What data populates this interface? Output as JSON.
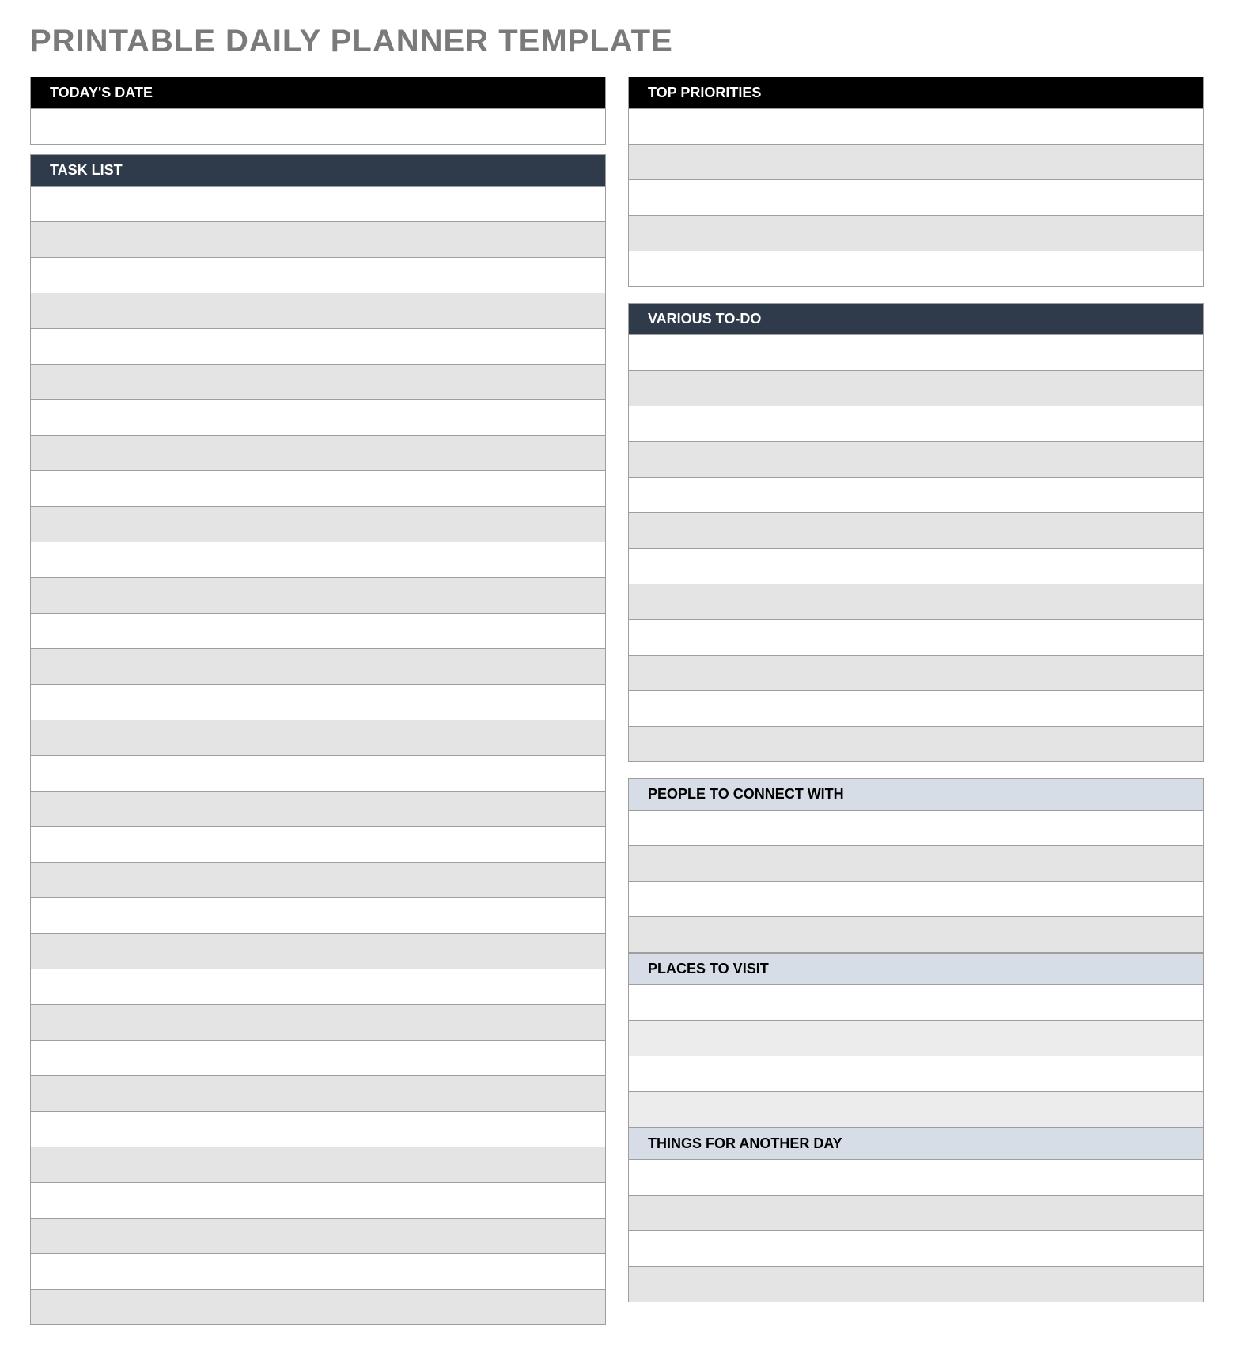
{
  "title": "PRINTABLE DAILY PLANNER TEMPLATE",
  "left": {
    "todays_date_header": "TODAY'S DATE",
    "task_list_header": "TASK LIST"
  },
  "right": {
    "top_priorities_header": "TOP PRIORITIES",
    "various_todo_header": "VARIOUS TO-DO",
    "people_header": "PEOPLE TO CONNECT WITH",
    "places_header": "PLACES TO VISIT",
    "things_header": "THINGS FOR ANOTHER DAY"
  }
}
